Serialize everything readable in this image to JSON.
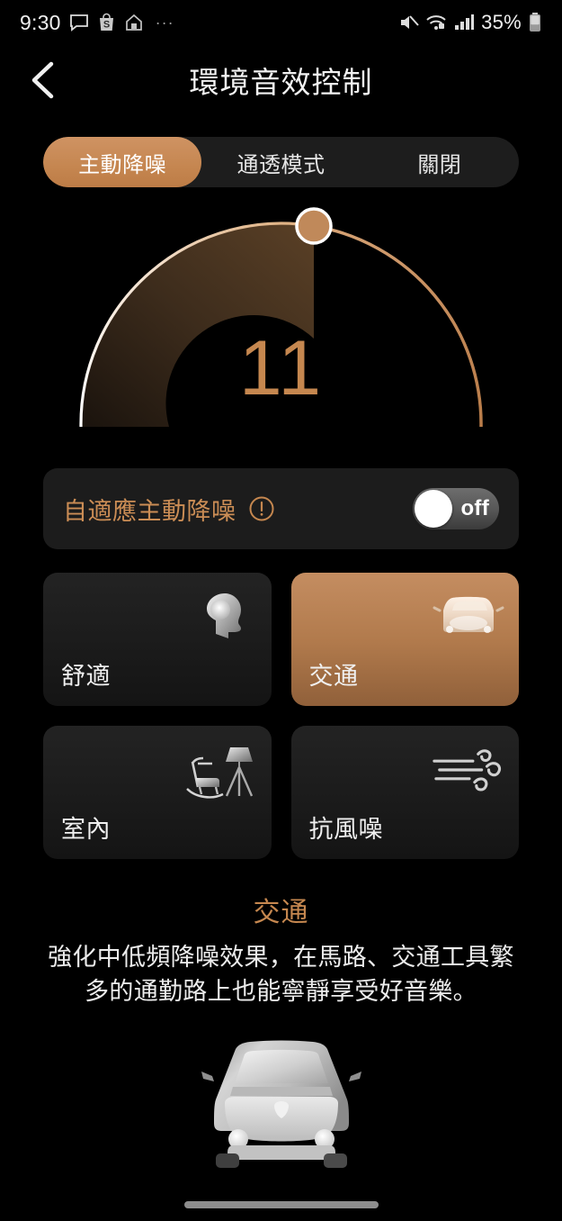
{
  "statusbar": {
    "time": "9:30",
    "left_icons": [
      "message-icon",
      "shopping-icon",
      "home-icon"
    ],
    "overflow": "···",
    "right_icons": [
      "mute-icon",
      "wifi-secured-icon",
      "cellular-signal-icon"
    ],
    "battery_text": "35%"
  },
  "header": {
    "back_label": "‹",
    "title": "環境音效控制"
  },
  "tabs": {
    "items": [
      {
        "label": "主動降噪",
        "selected": true
      },
      {
        "label": "通透模式",
        "selected": false
      },
      {
        "label": "關閉",
        "selected": false
      }
    ]
  },
  "dial": {
    "value": "11",
    "min": 0,
    "max": 20,
    "fill_color": "#C5874F",
    "track_color": "#C08552",
    "thumb_color": "#C08552"
  },
  "adaptive": {
    "label": "自適應主動降噪",
    "info_icon": "info-exclamation-icon",
    "toggle_state": "off",
    "toggle_label": "off"
  },
  "modes": [
    {
      "label": "舒適",
      "icon": "head-comfort-icon",
      "selected": false
    },
    {
      "label": "交通",
      "icon": "car-front-icon",
      "selected": true
    },
    {
      "label": "室內",
      "icon": "rocking-chair-lamp-icon",
      "selected": false
    },
    {
      "label": "抗風噪",
      "icon": "wind-icon",
      "selected": false
    }
  ],
  "description": {
    "title": "交通",
    "body": "強化中低頻降噪效果，在馬路、交通工具繁多的通勤路上也能寧靜享受好音樂。"
  },
  "hero": {
    "icon": "car-front-illustration"
  },
  "colors": {
    "accent": "#C5874F",
    "accent_light": "#CF9363",
    "background": "#000000",
    "card": "#1C1C1C"
  }
}
